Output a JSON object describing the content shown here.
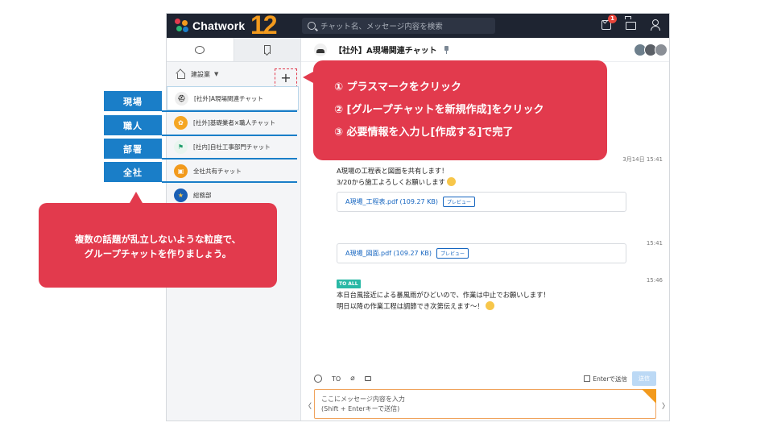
{
  "app": {
    "brand": "Chatwork",
    "anniversary": "12",
    "search_placeholder": "チャット名、メッセージ内容を検索",
    "task_badge": "1"
  },
  "sidebar": {
    "filter_label": "建設業",
    "rooms": [
      {
        "label": "[社外]A現場関連チャット",
        "icon": "helmet-avatar",
        "color": "#eeeeee"
      },
      {
        "label": "[社外]基礎業者×職人チャット",
        "icon": "orange-avatar",
        "color": "#f5a623"
      },
      {
        "label": "[社内]自社工事部門チャット",
        "icon": "green-flag-avatar",
        "color": "#1f9d6b"
      },
      {
        "label": "全社共有チャット",
        "icon": "orange-box-avatar",
        "color": "#f29a1d"
      },
      {
        "label": "総務部",
        "icon": "blue-star-avatar",
        "color": "#1a5fb4"
      }
    ]
  },
  "room": {
    "title": "【社外】A現場関連チャット",
    "messages": [
      {
        "time": "3月14日 15:41",
        "lines": [
          "A現場の工程表と図面を共有します！",
          "3/20から施工よろしくお願いします"
        ]
      },
      {
        "file": "A現場_工程表.pdf (109.27 KB)",
        "preview": "プレビュー"
      },
      {
        "time": "15:41",
        "file": "A現場_図面.pdf (109.27 KB)",
        "preview": "プレビュー"
      },
      {
        "time": "15:46",
        "to": "TO ALL",
        "lines": [
          "本日台風接近による暴風雨がひどいので、作業は中止でお願いします！",
          "明日以降の作業工程は調節でき次第伝えます〜！"
        ]
      }
    ]
  },
  "composer": {
    "to_label": "TO",
    "enter_label": "Enterで送信",
    "send_label": "送信",
    "placeholder_line1": "ここにメッセージ内容を入力",
    "placeholder_line2": "(Shift + Enterキーで送信)"
  },
  "annotations": {
    "tags": [
      "現場",
      "職人",
      "部署",
      "全社"
    ],
    "tag_color": "#1a7ec8",
    "accent_color": "#e23a4d",
    "steps": [
      "① プラスマークをクリック",
      "② [グループチャットを新規作成]をクリック",
      "③ 必要情報を入力し[作成する]で完了"
    ],
    "tip_line1": "複数の話題が乱立しないような粒度で、",
    "tip_line2": "グループチャットを作りましょう。"
  }
}
